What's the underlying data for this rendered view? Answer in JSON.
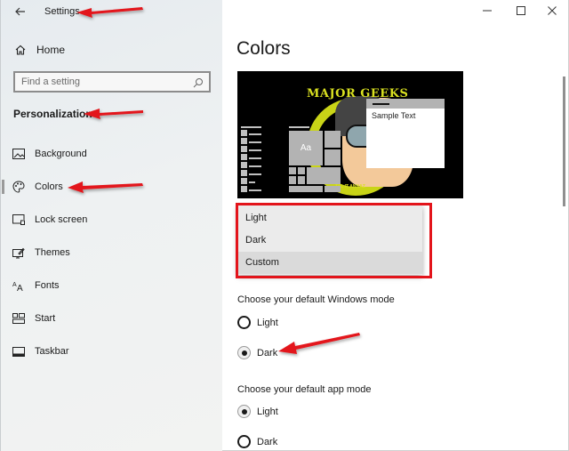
{
  "window": {
    "title": "Settings",
    "controls": {
      "minimize": "minimize",
      "maximize": "maximize",
      "close": "close"
    }
  },
  "sidebar": {
    "back_icon": "back-arrow-icon",
    "home_label": "Home",
    "search": {
      "placeholder": "Find a setting",
      "value": ""
    },
    "section_title": "Personalization",
    "items": [
      {
        "label": "Background",
        "icon": "picture-icon",
        "selected": false
      },
      {
        "label": "Colors",
        "icon": "palette-icon",
        "selected": true
      },
      {
        "label": "Lock screen",
        "icon": "lock-screen-icon",
        "selected": false
      },
      {
        "label": "Themes",
        "icon": "themes-icon",
        "selected": false
      },
      {
        "label": "Fonts",
        "icon": "fonts-icon",
        "selected": false
      },
      {
        "label": "Start",
        "icon": "start-icon",
        "selected": false
      },
      {
        "label": "Taskbar",
        "icon": "taskbar-icon",
        "selected": false
      }
    ]
  },
  "main": {
    "title": "Colors",
    "preview": {
      "brand_text": "MAJOR GEEKS",
      "tagline": "TAL IT ANNAZ",
      "sample_text": "Sample Text",
      "tile_text": "Aa"
    },
    "color_dropdown": {
      "options": [
        "Light",
        "Dark",
        "Custom"
      ],
      "selected": "Custom"
    },
    "windows_mode": {
      "label": "Choose your default Windows mode",
      "options": [
        "Light",
        "Dark"
      ],
      "selected": "Dark"
    },
    "app_mode": {
      "label": "Choose your default app mode",
      "options": [
        "Light",
        "Dark"
      ],
      "selected": "Light"
    }
  },
  "annotations": {
    "arrow_color": "#e3141b",
    "highlight_color": "#e3141b"
  }
}
